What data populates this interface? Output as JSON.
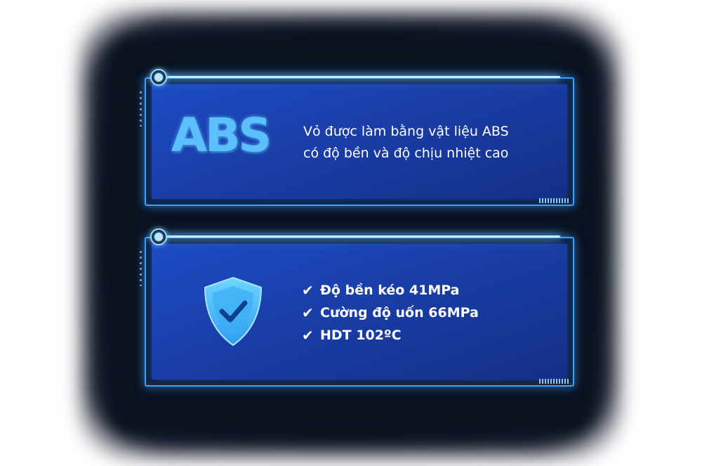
{
  "card_abs": {
    "logo_text": "ABS",
    "description_lines": [
      "Vỏ được làm bằng vật liệu ABS",
      "có độ bền và độ chịu nhiệt cao"
    ]
  },
  "card_specs": {
    "icon": "shield-check-icon",
    "check_glyph": "✔",
    "items": [
      "Độ bền kéo 41MPa",
      "Cường độ uốn 66MPa",
      "HDT 102ºC"
    ]
  },
  "colors": {
    "panel_blue": "#1c4bc4",
    "glow_blue": "#3aa2ff",
    "logo_cyan": "#5cc0ff",
    "background_dark": "#0a1220"
  }
}
